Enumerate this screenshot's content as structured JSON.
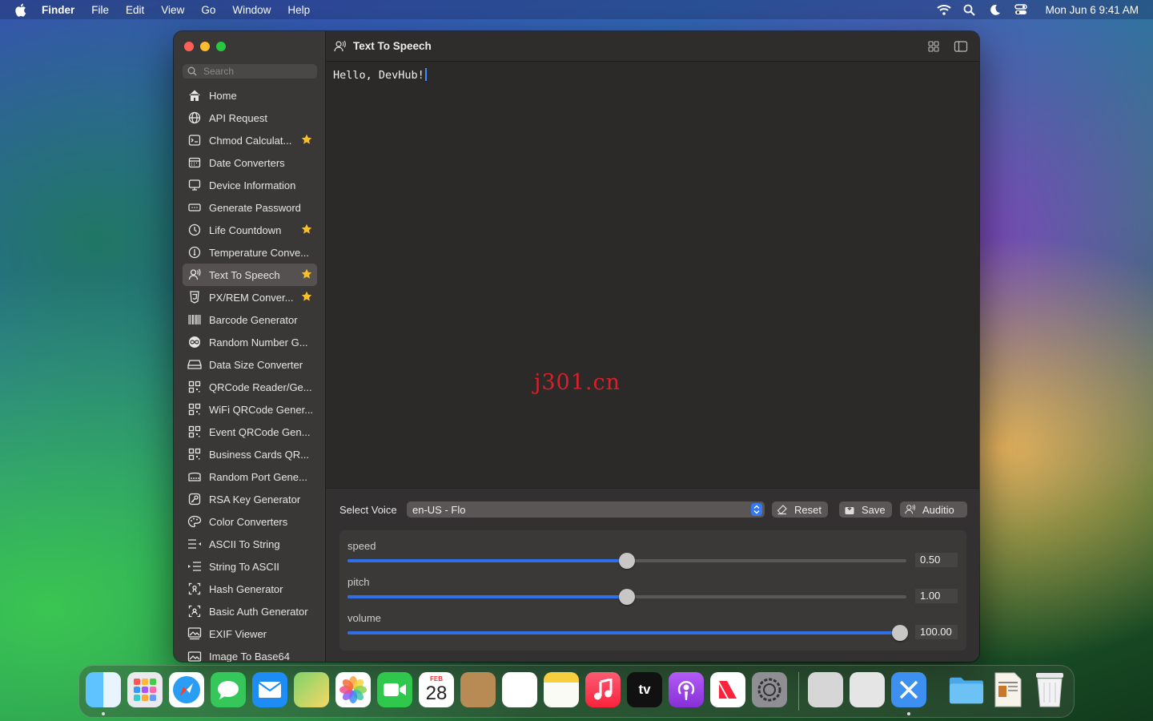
{
  "menubar": {
    "app_name": "Finder",
    "items": [
      "File",
      "Edit",
      "View",
      "Go",
      "Window",
      "Help"
    ],
    "clock": "Mon Jun 6  9:41 AM"
  },
  "sidebar": {
    "search_placeholder": "Search",
    "items": [
      {
        "label": "Home",
        "icon": "house-icon",
        "starred": false,
        "active": false
      },
      {
        "label": "API Request",
        "icon": "globe-icon",
        "starred": false,
        "active": false
      },
      {
        "label": "Chmod Calculat...",
        "icon": "terminal-icon",
        "starred": true,
        "active": false
      },
      {
        "label": "Date Converters",
        "icon": "calendar-icon",
        "starred": false,
        "active": false
      },
      {
        "label": "Device Information",
        "icon": "monitor-icon",
        "starred": false,
        "active": false
      },
      {
        "label": "Generate Password",
        "icon": "password-icon",
        "starred": false,
        "active": false
      },
      {
        "label": "Life Countdown",
        "icon": "timer-icon",
        "starred": true,
        "active": false
      },
      {
        "label": "Temperature Conve...",
        "icon": "thermometer-icon",
        "starred": false,
        "active": false
      },
      {
        "label": "Text To Speech",
        "icon": "speaker-person-icon",
        "starred": true,
        "active": true
      },
      {
        "label": "PX/REM Conver...",
        "icon": "css-icon",
        "starred": true,
        "active": false
      },
      {
        "label": "Barcode Generator",
        "icon": "barcode-icon",
        "starred": false,
        "active": false
      },
      {
        "label": "Random Number G...",
        "icon": "infinity-icon",
        "starred": false,
        "active": false
      },
      {
        "label": "Data Size Converter",
        "icon": "drive-icon",
        "starred": false,
        "active": false
      },
      {
        "label": "QRCode Reader/Ge...",
        "icon": "qrcode-icon",
        "starred": false,
        "active": false
      },
      {
        "label": "WiFi QRCode Gener...",
        "icon": "qrcode-icon",
        "starred": false,
        "active": false
      },
      {
        "label": "Event QRCode Gen...",
        "icon": "qrcode-icon",
        "starred": false,
        "active": false
      },
      {
        "label": "Business Cards QR...",
        "icon": "qrcode-icon",
        "starred": false,
        "active": false
      },
      {
        "label": "Random Port Gene...",
        "icon": "port-icon",
        "starred": false,
        "active": false
      },
      {
        "label": "RSA Key Generator",
        "icon": "key-icon",
        "starred": false,
        "active": false
      },
      {
        "label": "Color Converters",
        "icon": "palette-icon",
        "starred": false,
        "active": false
      },
      {
        "label": "ASCII To String",
        "icon": "list-arrow-left-icon",
        "starred": false,
        "active": false
      },
      {
        "label": "String To ASCII",
        "icon": "list-arrow-right-icon",
        "starred": false,
        "active": false
      },
      {
        "label": "Hash Generator",
        "icon": "hash-icon",
        "starred": false,
        "active": false
      },
      {
        "label": "Basic Auth Generator",
        "icon": "auth-icon",
        "starred": false,
        "active": false
      },
      {
        "label": "EXIF Viewer",
        "icon": "photo-icon",
        "starred": false,
        "active": false
      },
      {
        "label": "Image To Base64",
        "icon": "image-icon",
        "starred": false,
        "active": false
      }
    ]
  },
  "content": {
    "title": "Text To Speech",
    "editor_text": "Hello, DevHub!",
    "watermark": "j301.cn",
    "voice_label": "Select Voice",
    "voice_value": "en-US - Flo",
    "buttons": {
      "reset": "Reset",
      "save": "Save",
      "audition": "Auditio"
    },
    "sliders": [
      {
        "label": "speed",
        "value_text": "0.50",
        "fraction": 0.5
      },
      {
        "label": "pitch",
        "value_text": "1.00",
        "fraction": 0.5
      },
      {
        "label": "volume",
        "value_text": "100.00",
        "fraction": 1.0
      }
    ]
  },
  "dock": {
    "apps": [
      "finder-icon",
      "launchpad-icon",
      "safari-icon",
      "messages-icon",
      "mail-icon",
      "maps-icon",
      "photos-icon",
      "facetime-icon",
      "calendar-icon",
      "contacts-icon",
      "reminders-icon",
      "notes-icon",
      "music-icon",
      "tv-icon",
      "podcasts-icon",
      "news-icon",
      "system-settings-icon",
      "script-editor-icon",
      "preview-icon",
      "devhub-icon",
      "folder-icon",
      "document-icon",
      "trash-icon"
    ],
    "calendar_month": "FEB",
    "calendar_day": "28",
    "tv_label": "tv"
  },
  "colors": {
    "accent": "#2f6fe8",
    "star": "#f5c02b",
    "close": "#fe5f57",
    "minimize": "#febc2e",
    "maximize": "#28c840"
  }
}
